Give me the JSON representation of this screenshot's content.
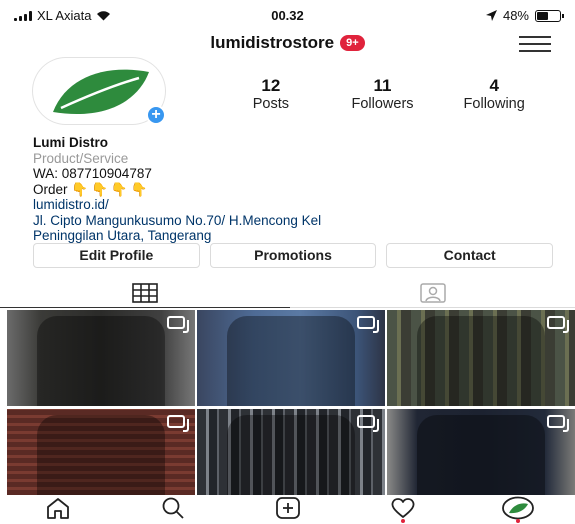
{
  "status_bar": {
    "carrier": "XL Axiata",
    "time": "00.32",
    "battery": "48%"
  },
  "header": {
    "username": "lumidistrostore",
    "notification_badge": "9+"
  },
  "profile": {
    "stats": [
      {
        "value": "12",
        "label": "Posts"
      },
      {
        "value": "11",
        "label": "Followers"
      },
      {
        "value": "4",
        "label": "Following"
      }
    ],
    "name": "Lumi Distro",
    "category": "Product/Service",
    "bio_line_1": "WA: 087710904787",
    "bio_line_2": "Order",
    "website": "lumidistro.id/",
    "address_line_1": "Jl. Cipto Mangunkusumo No.70/ H.Mencong Kel",
    "address_line_2": "Peninggilan Utara, Tangerang"
  },
  "buttons": {
    "edit_profile": "Edit Profile",
    "promotions": "Promotions",
    "contact": "Contact"
  },
  "colors": {
    "accent_blue": "#3897f0",
    "badge_red": "#e0233c",
    "logo_green": "#2e8b3d",
    "link": "#003569"
  },
  "icons": {
    "grid_tab": "grid-icon",
    "tagged_tab": "tagged-photos-icon",
    "multi_photo": "multiple-photos-icon",
    "nav": [
      "home-icon",
      "search-icon",
      "add-post-icon",
      "activity-heart-icon",
      "profile-avatar-icon"
    ]
  }
}
